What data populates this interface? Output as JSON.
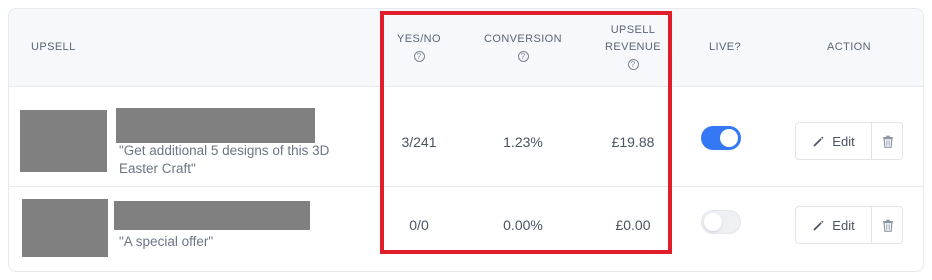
{
  "headers": {
    "upsell": "UPSELL",
    "yes_no": "YES/NO",
    "conversion": "CONVERSION",
    "revenue_line1": "UPSELL",
    "revenue_line2": "REVENUE",
    "live": "LIVE?",
    "action": "ACTION",
    "help_glyph": "?"
  },
  "rows": [
    {
      "description": "\"Get additional 5 designs of this 3D Easter Craft\"",
      "yes_no": "3/241",
      "conversion": "1.23%",
      "revenue": "£19.88",
      "live": true,
      "edit_label": "Edit"
    },
    {
      "description": "\"A special offer\"",
      "yes_no": "0/0",
      "conversion": "0.00%",
      "revenue": "£0.00",
      "live": false,
      "edit_label": "Edit"
    }
  ],
  "colors": {
    "highlight": "#e01e2a",
    "toggle_on": "#3478f6",
    "redacted": "#808080"
  },
  "icons": {
    "help": "help-circle-icon",
    "edit": "pencil-icon",
    "delete": "trash-icon"
  }
}
